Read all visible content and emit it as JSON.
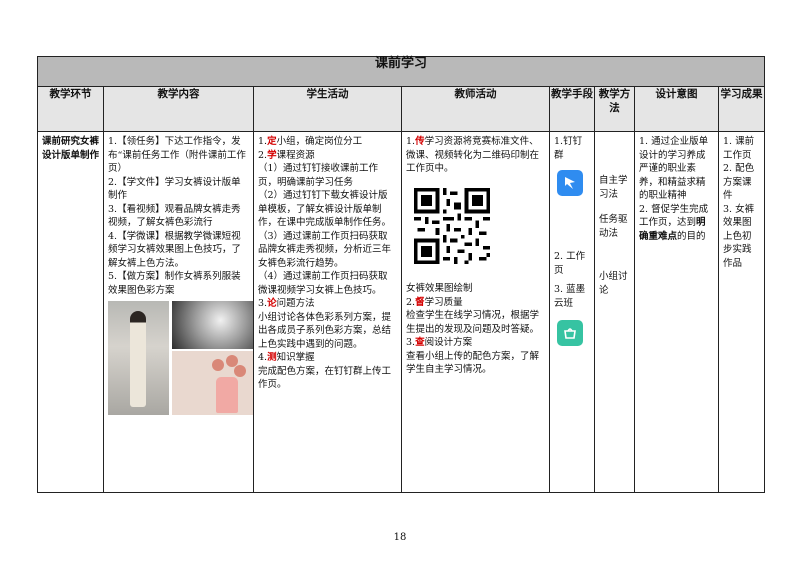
{
  "table": {
    "title": "课前学习",
    "headers": [
      "教学环节",
      "教学内容",
      "学生活动",
      "教师活动",
      "教学手段",
      "教学方法",
      "设计意图",
      "学习成果"
    ],
    "stage": "课前研究女裤设计版单制作",
    "content_lines": [
      "1.【领任务】下达工作指令，发布“课前任务工作（附件课前工作页）",
      "2.【学文件】学习女裤设计版单制作",
      "3.【看视频】观看品牌女裤走秀视频，了解女裤色彩流行",
      "4.【学微课】根据教学微课短视频学习女裤效果图上色技巧，了解女裤上色方法。",
      "5.【做方案】制作女裤系列服装效果图色彩方案"
    ],
    "student": {
      "s1_num": "1.",
      "s1_key": "定",
      "s1_rest": "小组，确定岗位分工",
      "s2_num": "2.",
      "s2_key": "学",
      "s2_rest": "课程资源",
      "s2_a": "（1）通过钉钉接收课前工作页，明确课前学习任务",
      "s2_b": "（2）通过钉钉下载女裤设计版单模板，了解女裤设计版单制作，在课中完成版单制作任务。",
      "s2_c": "（3）通过课前工作页扫码获取品牌女裤走秀视频，分析近三年女裤色彩流行趋势。",
      "s2_d": "（4）通过课前工作页扫码获取微课视频学习女裤上色技巧。",
      "s3_num": "3.",
      "s3_key": "论",
      "s3_rest": "问题方法",
      "s3_text": "小组讨论各体色彩系列方案，提出各成员子系列色彩方案，总结上色实践中遇到的问题。",
      "s4_num": "4.",
      "s4_key": "测",
      "s4_rest": "知识掌握",
      "s4_text": "完成配色方案，在钉钉群上传工作页。"
    },
    "teacher": {
      "t1_num": "1.",
      "t1_key": "传",
      "t1_rest": "学习资源将竞赛标准文件、微课、视频转化为二维码印制在工作页中。",
      "qr_caption": "女裤效果图绘制",
      "t2_num": "2.",
      "t2_key": "督",
      "t2_rest": "学习质量",
      "t2_text": "检查学生在线学习情况，根据学生提出的发现及问题及时答疑。",
      "t3_num": "3.",
      "t3_key": "查",
      "t3_rest": "阅设计方案",
      "t3_text": "查看小组上传的配色方案，了解学生自主学习情况。"
    },
    "means": {
      "m1": "1.钉钉群",
      "m2": "2. 工作页",
      "m3": "3. 蓝墨云班",
      "icon_dingtalk": "dingtalk-app-icon",
      "icon_lanmo": "lanmo-cloud-class-app-icon"
    },
    "methods": [
      "自主学习法",
      "任务驱动法",
      "小组讨论"
    ],
    "design": {
      "d1": "1. 通过企业版单设计的学习养成严谨的职业素养，和精益求精的职业精神",
      "d2_pre": "2. 督促学生完成工作页，达到",
      "d2_bold": "明确重难点",
      "d2_post": "的目的"
    },
    "outcomes": [
      "1. 课前工作页",
      "2. 配色方案课件",
      "3. 女裤效果图上色初步实践作品"
    ]
  },
  "page_number": "18"
}
